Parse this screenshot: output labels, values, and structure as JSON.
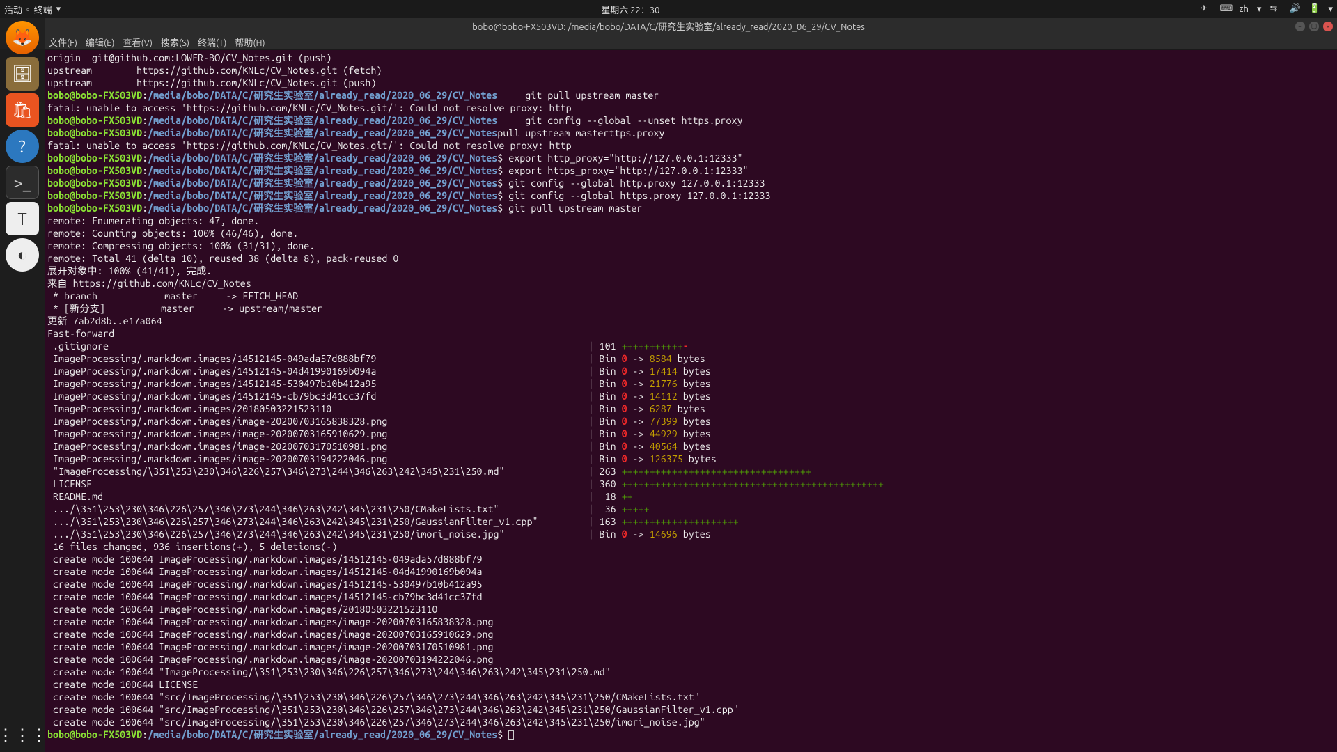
{
  "topbar": {
    "activities": "活动",
    "appmenu": "终端",
    "date": "星期六 22：30",
    "lang": "zh"
  },
  "window": {
    "title": "bobo@bobo-FX503VD: /media/bobo/DATA/C/研究生实验室/already_read/2020_06_29/CV_Notes"
  },
  "menu": [
    "文件(F)",
    "编辑(E)",
    "查看(V)",
    "搜索(S)",
    "终端(T)",
    "帮助(H)"
  ],
  "prompt": {
    "user": "bobo@bobo-FX503VD",
    "sep": ":",
    "path": "/media/bobo/DATA/C/研究生实验室/already_read/2020_06_29/CV_Notes",
    "dollar": "$"
  },
  "lines": {
    "l0": "origin  git@github.com:LOWER-BO/CV_Notes.git (push)",
    "l1": "upstream        https://github.com/KNLc/CV_Notes.git (fetch)",
    "l2": "upstream        https://github.com/KNLc/CV_Notes.git (push)",
    "cmd1": "     git pull upstream master",
    "l3": "fatal: unable to access 'https://github.com/KNLc/CV_Notes.git/': Could not resolve proxy: http",
    "cmd2": "     git config --global --unset https.proxy",
    "l4": "pull upstream masterttps.proxy",
    "l5": "fatal: unable to access 'https://github.com/KNLc/CV_Notes.git/': Could not resolve proxy: http",
    "cmd3": "$ export http_proxy=\"http://127.0.0.1:12333\"",
    "cmd4": "$ export https_proxy=\"http://127.0.0.1:12333\"",
    "cmd5": "$ git config --global http.proxy 127.0.0.1:12333",
    "cmd6": "$ git config --global https.proxy 127.0.0.1:12333",
    "cmd7": "$ git pull upstream master",
    "rem1": "remote: Enumerating objects: 47, done.",
    "rem2": "remote: Counting objects: 100% (46/46), done.",
    "rem3": "remote: Compressing objects: 100% (31/31), done.",
    "rem4": "remote: Total 41 (delta 10), reused 38 (delta 8), pack-reused 0",
    "rem5": "展开对象中: 100% (41/41), 完成.",
    "rem6": "来自 https://github.com/KNLc/CV_Notes",
    "rem7": " * branch            master     -> FETCH_HEAD",
    "rem8": " * [新分支]          master     -> upstream/master",
    "rem9": "更新 7ab2d8b..e17a064",
    "ff": "Fast-forward",
    "diff": [
      {
        "file": " .gitignore",
        "mid": "| 101 ",
        "tail": "",
        "plus": "+++++++++++",
        "minus": "-"
      },
      {
        "file": " ImageProcessing/.markdown.images/14512145-049ada57d888bf79",
        "mid": "| Bin ",
        "zero": "0",
        "arrow": " -> ",
        "num": "8584",
        "unit": " bytes"
      },
      {
        "file": " ImageProcessing/.markdown.images/14512145-04d41990169b094a",
        "mid": "| Bin ",
        "zero": "0",
        "arrow": " -> ",
        "num": "17414",
        "unit": " bytes"
      },
      {
        "file": " ImageProcessing/.markdown.images/14512145-530497b10b412a95",
        "mid": "| Bin ",
        "zero": "0",
        "arrow": " -> ",
        "num": "21776",
        "unit": " bytes"
      },
      {
        "file": " ImageProcessing/.markdown.images/14512145-cb79bc3d41cc37fd",
        "mid": "| Bin ",
        "zero": "0",
        "arrow": " -> ",
        "num": "14112",
        "unit": " bytes"
      },
      {
        "file": " ImageProcessing/.markdown.images/20180503221523110",
        "mid": "| Bin ",
        "zero": "0",
        "arrow": " -> ",
        "num": "6287",
        "unit": " bytes"
      },
      {
        "file": " ImageProcessing/.markdown.images/image-20200703165838328.png",
        "mid": "| Bin ",
        "zero": "0",
        "arrow": " -> ",
        "num": "77399",
        "unit": " bytes"
      },
      {
        "file": " ImageProcessing/.markdown.images/image-20200703165910629.png",
        "mid": "| Bin ",
        "zero": "0",
        "arrow": " -> ",
        "num": "44929",
        "unit": " bytes"
      },
      {
        "file": " ImageProcessing/.markdown.images/image-20200703170510981.png",
        "mid": "| Bin ",
        "zero": "0",
        "arrow": " -> ",
        "num": "40564",
        "unit": " bytes"
      },
      {
        "file": " ImageProcessing/.markdown.images/image-20200703194222046.png",
        "mid": "| Bin ",
        "zero": "0",
        "arrow": " -> ",
        "num": "126375",
        "unit": " bytes"
      },
      {
        "file": " \"ImageProcessing/\\351\\253\\230\\346\\226\\257\\346\\273\\244\\346\\263\\242\\345\\231\\250.md\"",
        "mid": "| 263 ",
        "plus": "++++++++++++++++++++++++++++++++++"
      },
      {
        "file": " LICENSE",
        "mid": "| 360 ",
        "plus": "+++++++++++++++++++++++++++++++++++++++++++++++"
      },
      {
        "file": " README.md",
        "mid": "|  18 ",
        "plus": "++"
      },
      {
        "file": " .../\\351\\253\\230\\346\\226\\257\\346\\273\\244\\346\\263\\242\\345\\231\\250/CMakeLists.txt\"",
        "mid": "|  36 ",
        "plus": "+++++"
      },
      {
        "file": " .../\\351\\253\\230\\346\\226\\257\\346\\273\\244\\346\\263\\242\\345\\231\\250/GaussianFilter_v1.cpp\"",
        "mid": "| 163 ",
        "plus": "+++++++++++++++++++++"
      },
      {
        "file": " .../\\351\\253\\230\\346\\226\\257\\346\\273\\244\\346\\263\\242\\345\\231\\250/imori_noise.jpg\"",
        "mid": "| Bin ",
        "zero": "0",
        "arrow": " -> ",
        "num": "14696",
        "unit": " bytes"
      }
    ],
    "summary": " 16 files changed, 936 insertions(+), 5 deletions(-)",
    "creates": [
      " create mode 100644 ImageProcessing/.markdown.images/14512145-049ada57d888bf79",
      " create mode 100644 ImageProcessing/.markdown.images/14512145-04d41990169b094a",
      " create mode 100644 ImageProcessing/.markdown.images/14512145-530497b10b412a95",
      " create mode 100644 ImageProcessing/.markdown.images/14512145-cb79bc3d41cc37fd",
      " create mode 100644 ImageProcessing/.markdown.images/20180503221523110",
      " create mode 100644 ImageProcessing/.markdown.images/image-20200703165838328.png",
      " create mode 100644 ImageProcessing/.markdown.images/image-20200703165910629.png",
      " create mode 100644 ImageProcessing/.markdown.images/image-20200703170510981.png",
      " create mode 100644 ImageProcessing/.markdown.images/image-20200703194222046.png",
      " create mode 100644 \"ImageProcessing/\\351\\253\\230\\346\\226\\257\\346\\273\\244\\346\\263\\242\\345\\231\\250.md\"",
      " create mode 100644 LICENSE",
      " create mode 100644 \"src/ImageProcessing/\\351\\253\\230\\346\\226\\257\\346\\273\\244\\346\\263\\242\\345\\231\\250/CMakeLists.txt\"",
      " create mode 100644 \"src/ImageProcessing/\\351\\253\\230\\346\\226\\257\\346\\273\\244\\346\\263\\242\\345\\231\\250/GaussianFilter_v1.cpp\"",
      " create mode 100644 \"src/ImageProcessing/\\351\\253\\230\\346\\226\\257\\346\\273\\244\\346\\263\\242\\345\\231\\250/imori_noise.jpg\""
    ]
  }
}
